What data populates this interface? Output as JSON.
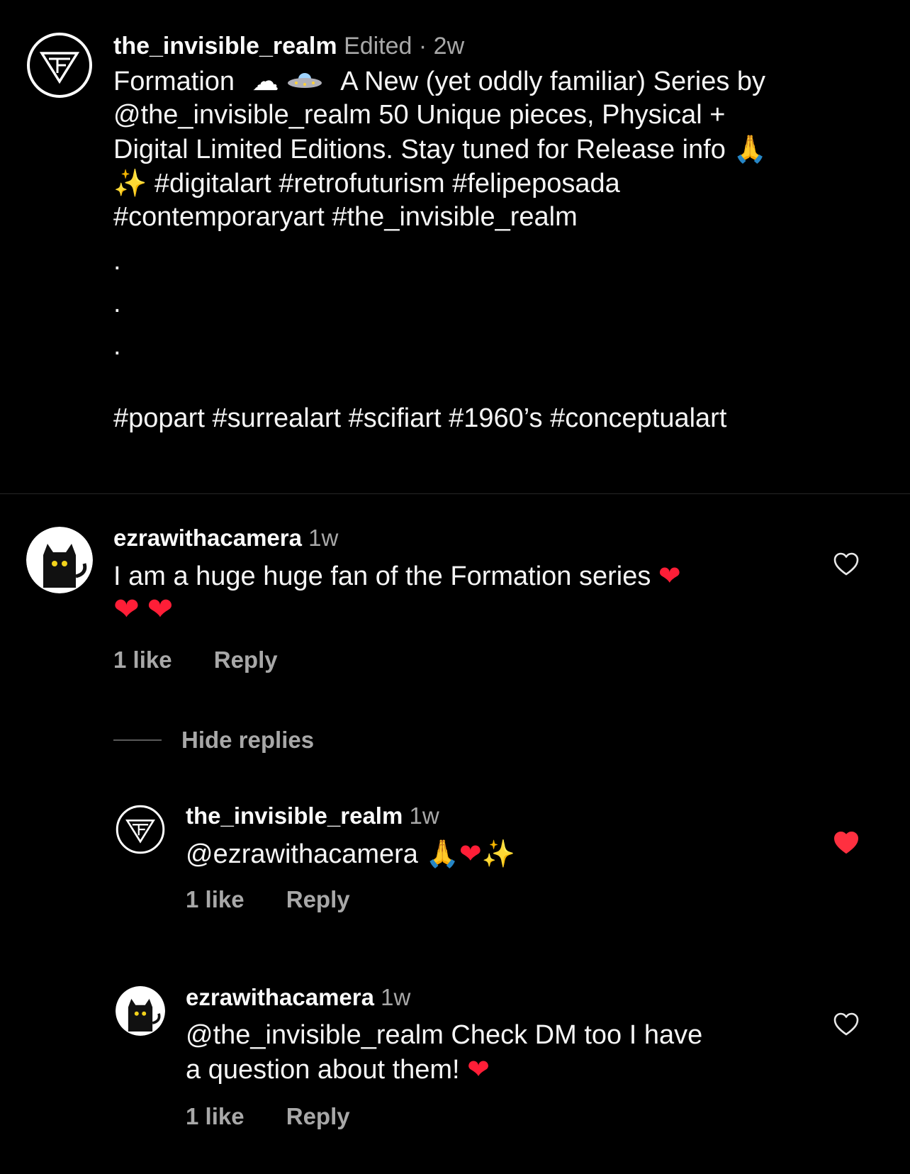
{
  "post": {
    "author": "the_invisible_realm",
    "meta": "Edited · 2w",
    "caption_lines": [
      "Formation",
      "A New (yet oddly familiar) Series by",
      "@the_invisible_realm 50 Unique pieces, Physical +",
      "Digital Limited Editions. Stay tuned for Release info",
      "#digitalart #retrofuturism #felipeposada",
      "#contemporaryart  #the_invisible_realm"
    ],
    "dots": [
      ".",
      ".",
      "."
    ],
    "hashtags_line": "#popart #surrealart #scifiart #1960’s #conceptualart"
  },
  "comments": [
    {
      "username": "ezrawithacamera",
      "time": "1w",
      "lines": [
        "I am a huge huge fan of the Formation series"
      ],
      "likes": "1 like",
      "reply_label": "Reply",
      "liked": false
    }
  ],
  "hide_replies_label": "Hide replies",
  "replies": [
    {
      "username": "the_invisible_realm",
      "time": "1w",
      "lines": [
        "@ezrawithacamera"
      ],
      "likes": "1 like",
      "reply_label": "Reply",
      "liked": true
    },
    {
      "username": "ezrawithacamera",
      "time": "1w",
      "lines": [
        "@the_invisible_realm Check DM too I have",
        "a question about them!"
      ],
      "likes": "1 like",
      "reply_label": "Reply",
      "liked": false
    }
  ],
  "icons": {
    "author_avatar": "triangle-logo-icon",
    "commenter_avatar": "black-cat-icon",
    "like": "heart-outline-icon",
    "liked": "heart-filled-icon"
  },
  "colors": {
    "background": "#000000",
    "text_primary": "#f5f5f5",
    "text_secondary": "#a8a8a8",
    "like_red": "#ff3040"
  }
}
